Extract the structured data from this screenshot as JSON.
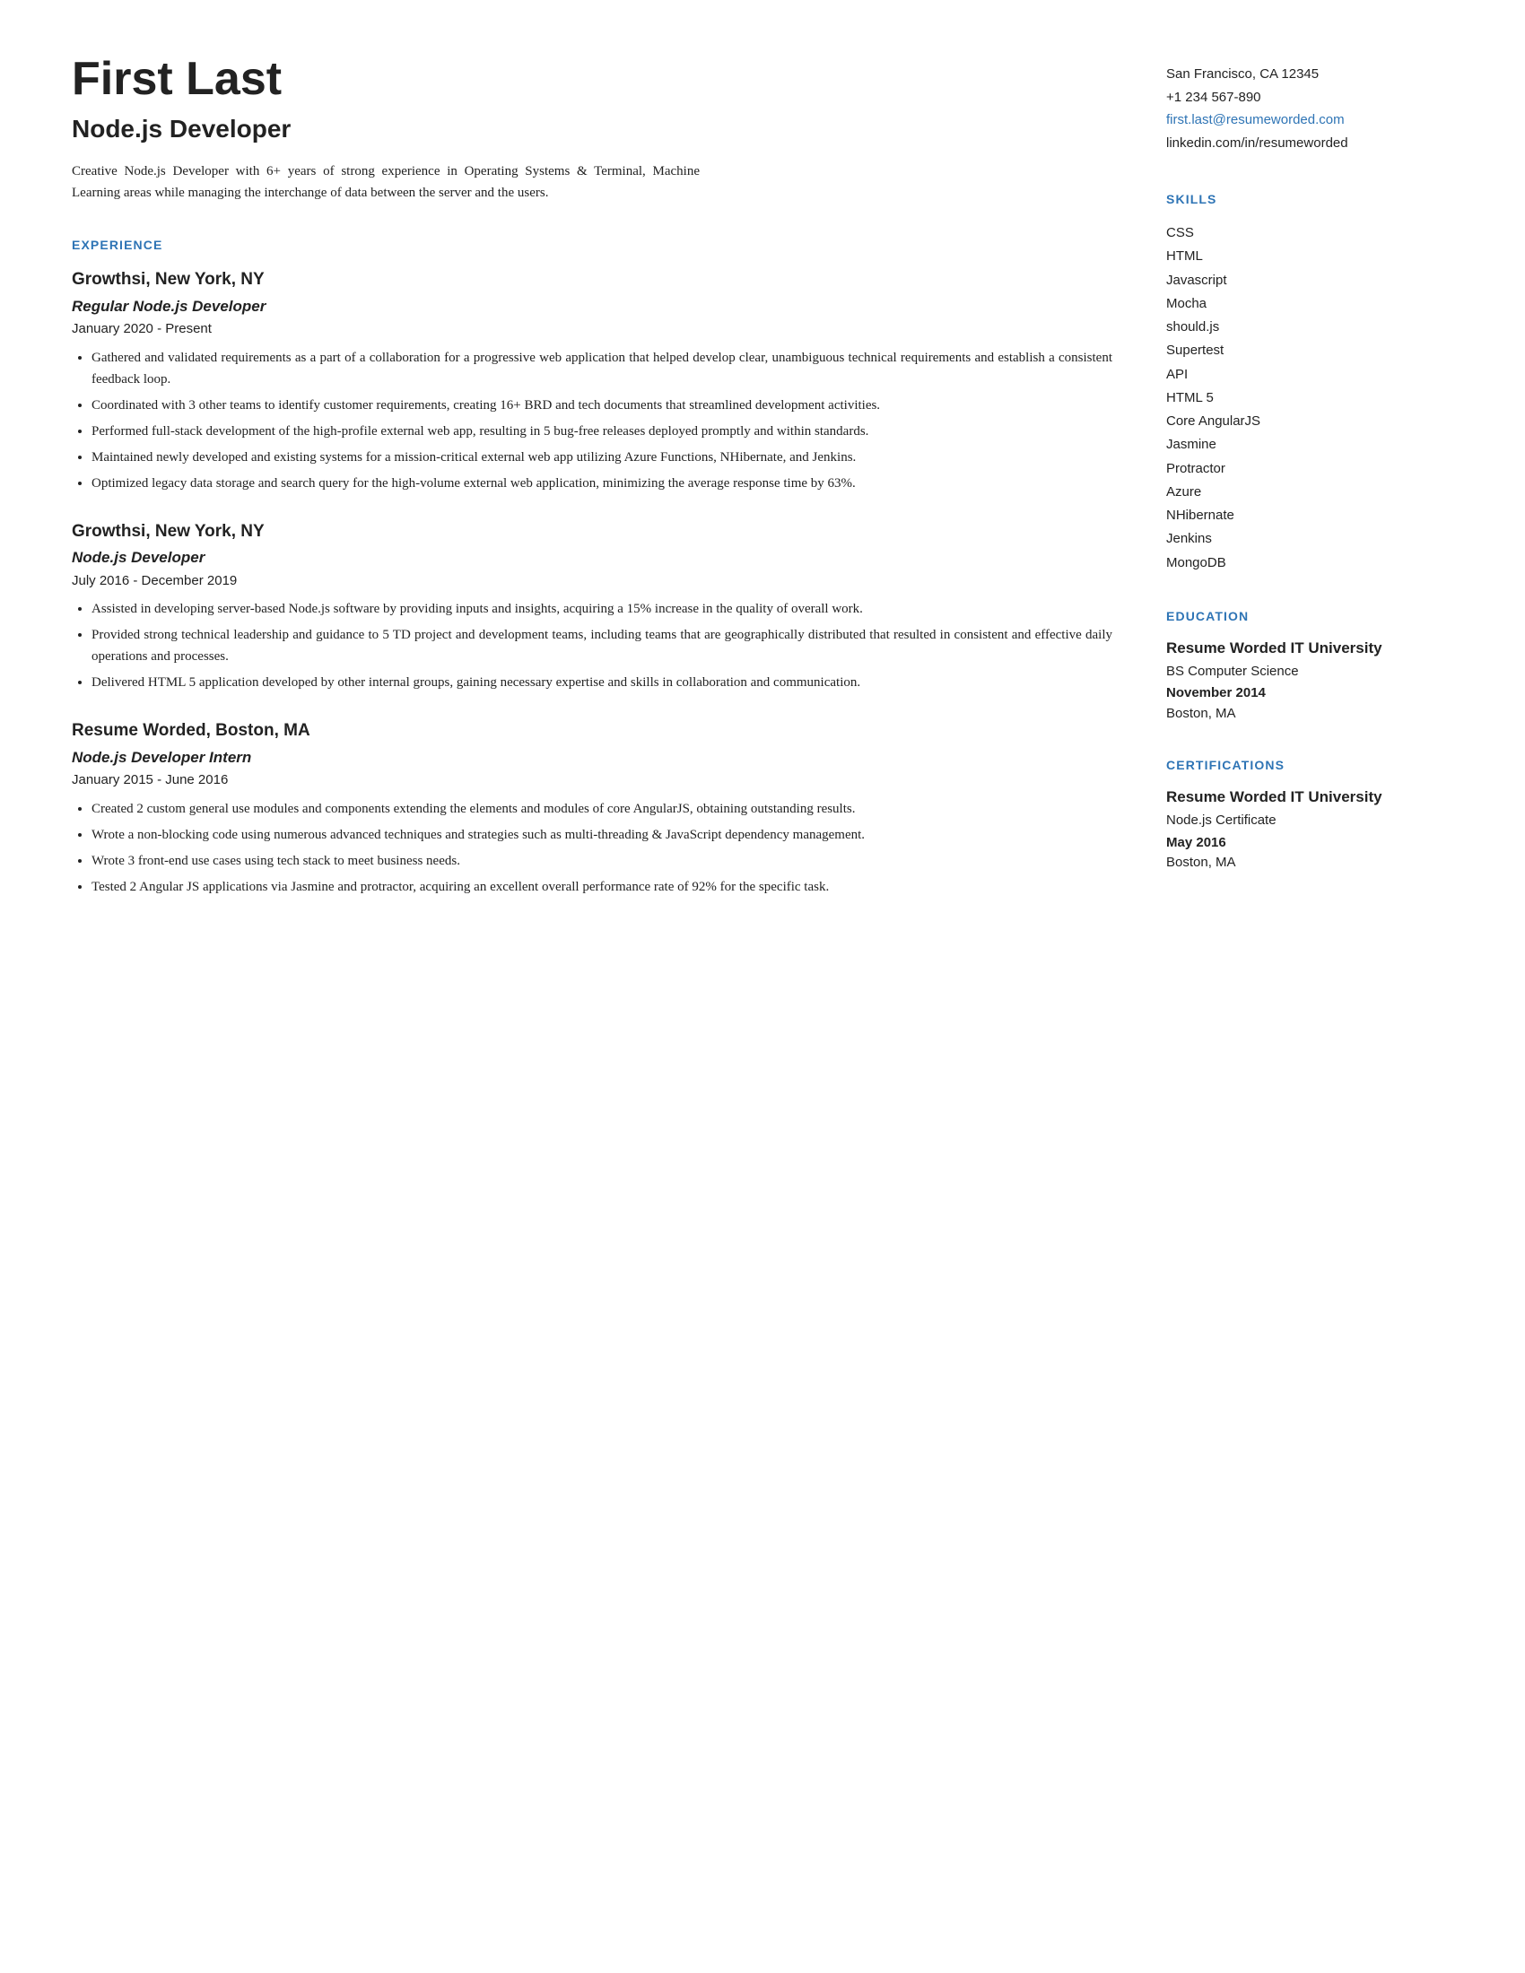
{
  "header": {
    "name": "First Last",
    "title": "Node.js Developer",
    "summary": "Creative Node.js Developer with 6+ years of strong experience in Operating Systems & Terminal, Machine Learning areas while managing the interchange of data between the server and the users."
  },
  "contact": {
    "address": "San Francisco, CA 12345",
    "phone": "+1 234 567-890",
    "email": "first.last@resumeworded.com",
    "linkedin": "linkedin.com/in/resumeworded"
  },
  "sections": {
    "experience_label": "EXPERIENCE",
    "skills_label": "SKILLS",
    "education_label": "EDUCATION",
    "certifications_label": "CERTIFICATIONS"
  },
  "experience": [
    {
      "company": "Growthsi,",
      "location": " New York, NY",
      "title": "Regular Node.js Developer",
      "dates": "January 2020 - Present",
      "bullets": [
        "Gathered and validated requirements as a part of a collaboration for a progressive web application that helped develop clear, unambiguous technical requirements and establish a consistent feedback loop.",
        "Coordinated with 3 other teams to identify customer requirements, creating 16+ BRD and tech documents that streamlined development activities.",
        "Performed full-stack development of the high-profile external web app, resulting in 5 bug-free releases deployed promptly and within standards.",
        "Maintained newly developed and existing systems for a mission-critical external web app utilizing Azure Functions, NHibernate, and Jenkins.",
        "Optimized legacy data storage and search query for the high-volume external web application, minimizing the average response time by 63%."
      ]
    },
    {
      "company": "Growthsi,",
      "location": " New York, NY",
      "title": "Node.js Developer",
      "dates": "July 2016 - December 2019",
      "bullets": [
        "Assisted in developing server-based Node.js software by providing inputs and insights, acquiring a 15% increase in the quality of overall work.",
        "Provided strong technical leadership and guidance to 5 TD project and development teams, including teams that are geographically distributed that resulted in consistent and effective daily operations and processes.",
        "Delivered HTML 5 application developed by other internal groups, gaining necessary expertise and skills in collaboration and communication."
      ]
    },
    {
      "company": "Resume Worded,",
      "location": " Boston, MA",
      "title": "Node.js Developer Intern",
      "dates": "January 2015 - June 2016",
      "bullets": [
        "Created 2 custom general use modules and components extending the elements and modules of core AngularJS, obtaining outstanding results.",
        "Wrote a non-blocking code using numerous advanced techniques and strategies such as multi-threading & JavaScript dependency management.",
        "Wrote 3 front-end use cases using tech stack to meet business needs.",
        "Tested 2 Angular JS applications via Jasmine and protractor, acquiring an excellent overall performance rate of 92% for the specific task."
      ]
    }
  ],
  "skills": [
    "CSS",
    "HTML",
    "Javascript",
    "Mocha",
    "should.js",
    "Supertest",
    "API",
    "HTML 5",
    "Core AngularJS",
    "Jasmine",
    "Protractor",
    "Azure",
    "NHibernate",
    "Jenkins",
    "MongoDB"
  ],
  "education": [
    {
      "school": "Resume Worded IT University",
      "degree": "BS Computer Science",
      "date": "November 2014",
      "location": "Boston, MA"
    }
  ],
  "certifications": [
    {
      "school": "Resume Worded IT University",
      "name": "Node.js Certificate",
      "date": "May 2016",
      "location": "Boston, MA"
    }
  ]
}
